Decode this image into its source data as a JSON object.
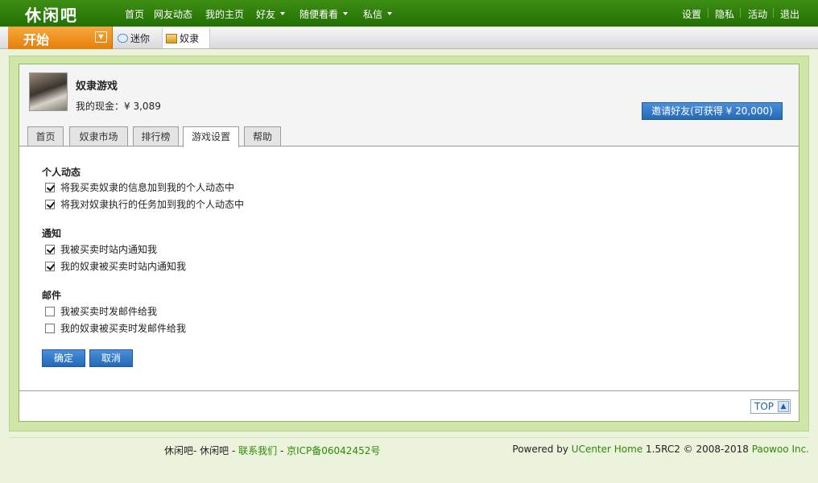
{
  "topnav": {
    "logo": "休闲吧",
    "items": [
      {
        "label": "首页"
      },
      {
        "label": "网友动态"
      },
      {
        "label": "我的主页"
      },
      {
        "label": "好友"
      },
      {
        "label": "随便看看"
      },
      {
        "label": "私信"
      }
    ],
    "right_items": [
      {
        "label": "设置"
      },
      {
        "label": "隐私"
      },
      {
        "label": "活动"
      },
      {
        "label": "退出"
      }
    ]
  },
  "appbar": {
    "start_label": "开始",
    "tabs": [
      {
        "label": "迷你",
        "icon": "chat-bubble-icon"
      },
      {
        "label": "奴隶",
        "icon": "box-icon"
      }
    ]
  },
  "game": {
    "title": "奴隶游戏",
    "cash_label": "我的现金：",
    "currency": "¥",
    "cash_value": "3,089",
    "invite_button": "邀请好友(可获得 ¥ 20,000)"
  },
  "tabs": [
    {
      "label": "首页",
      "active": false
    },
    {
      "label": "奴隶市场",
      "active": false
    },
    {
      "label": "排行榜",
      "active": false
    },
    {
      "label": "游戏设置",
      "active": true
    },
    {
      "label": "帮助",
      "active": false
    }
  ],
  "settings": {
    "sections": [
      {
        "heading": "个人动态",
        "options": [
          {
            "label": "将我买卖奴隶的信息加到我的个人动态中",
            "checked": true
          },
          {
            "label": "将我对奴隶执行的任务加到我的个人动态中",
            "checked": true
          }
        ]
      },
      {
        "heading": "通知",
        "options": [
          {
            "label": "我被买卖时站内通知我",
            "checked": true
          },
          {
            "label": "我的奴隶被买卖时站内通知我",
            "checked": true
          }
        ]
      },
      {
        "heading": "邮件",
        "options": [
          {
            "label": "我被买卖时发邮件给我",
            "checked": false
          },
          {
            "label": "我的奴隶被买卖时发邮件给我",
            "checked": false
          }
        ]
      }
    ],
    "confirm_label": "确定",
    "cancel_label": "取消"
  },
  "top_button": "TOP",
  "footer": {
    "site": "休闲吧- 休闲吧",
    "dash": " - ",
    "contact": "联系我们",
    "icp": "京ICP备06042452号",
    "powered_by": "Powered by ",
    "product": "UCenter Home",
    "version": " 1.5RC2 © 2008-2018 ",
    "company": "Paowoo Inc."
  },
  "colors": {
    "nav_green": "#237004",
    "start_orange": "#e57f08",
    "button_blue": "#2668b8",
    "link_green": "#2d8a07"
  }
}
